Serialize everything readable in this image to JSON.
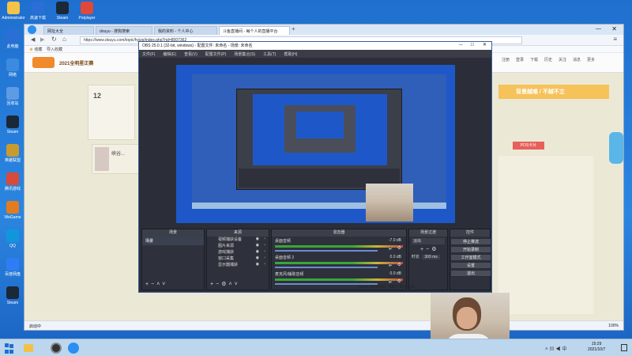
{
  "desktop": {
    "icons": [
      {
        "label": "此电脑",
        "color": "#2b6fd6"
      },
      {
        "label": "网络",
        "color": "#3c8be0"
      },
      {
        "label": "回收站",
        "color": "#5d9be5"
      },
      {
        "label": "Steam",
        "color": "#1b2838"
      },
      {
        "label": "英雄联盟",
        "color": "#c99a2e"
      },
      {
        "label": "腾讯游戏",
        "color": "#d94a3a"
      },
      {
        "label": "WeGame",
        "color": "#e37b1f"
      },
      {
        "label": "QQ",
        "color": "#1296db"
      },
      {
        "label": "百度网盘",
        "color": "#2f7df6"
      },
      {
        "label": "Steam",
        "color": "#1b2838"
      }
    ],
    "top_icons": [
      {
        "label": "Administrator",
        "color": "#f3c34a"
      },
      {
        "label": "高速下载",
        "color": "#2b6fd6"
      },
      {
        "label": "Steam",
        "color": "#1b2838"
      },
      {
        "label": "Potplayer",
        "color": "#e0483b"
      }
    ]
  },
  "browser": {
    "tabs": [
      "网址大全",
      "douyu - 搜狗搜索",
      "我的资料 - 个人中心",
      "斗鱼直播间 - 每个人的直播平台"
    ],
    "url": "https://www.douyu.com/topic/hyjzp/index.php?rid=8007362",
    "bookmark_label": "收藏",
    "bookmark_import": "导入收藏",
    "site_logo": "2021全明星正赛",
    "site_nav_right": [
      "注册",
      "登录",
      "下载",
      "历史",
      "关注",
      "消息",
      "更多"
    ],
    "banner_text": "背景越难 / 不越不立",
    "stat_num": "12",
    "card_title": "峡谷...",
    "pos_label": "POS卡片",
    "status_zoom": "100%",
    "status_left": "启动中"
  },
  "obs": {
    "title": "OBS 25.0.1 (32-bit, windows) - 配置文件: 未命名 - 场景: 未命名",
    "menu": [
      "文件(F)",
      "编辑(E)",
      "查看(V)",
      "配置文件(P)",
      "场景集合(S)",
      "工具(T)",
      "帮助(H)"
    ],
    "docks": {
      "scenes": {
        "header": "场景",
        "items": [
          "场景"
        ]
      },
      "sources": {
        "header": "来源",
        "items": [
          "视频捕获设备",
          "图片来源",
          "游戏捕获",
          "窗口采集",
          "显示器捕获"
        ]
      },
      "mixer": {
        "header": "混音器",
        "channels": [
          {
            "name": "桌面音频",
            "db": "-7.0 dB"
          },
          {
            "name": "桌面音频 2",
            "db": "0.0 dB"
          },
          {
            "name": "麦克风/辅助音频",
            "db": "0.0 dB"
          }
        ]
      },
      "transitions": {
        "header": "场景过渡",
        "type": "淡出",
        "duration_label": "时长",
        "duration": "300 ms"
      },
      "controls": {
        "header": "控件",
        "buttons": [
          "停止推流",
          "开始录制",
          "工作室模式",
          "设置",
          "退出"
        ]
      }
    },
    "status": {
      "live": "LIVE: 00:00:00",
      "rec": "REC: 00:00:00",
      "cpu": "CPU: 3.1%, 30.00 fps"
    }
  },
  "taskbar": {
    "time": "15:29",
    "date": "2021/10/7"
  }
}
